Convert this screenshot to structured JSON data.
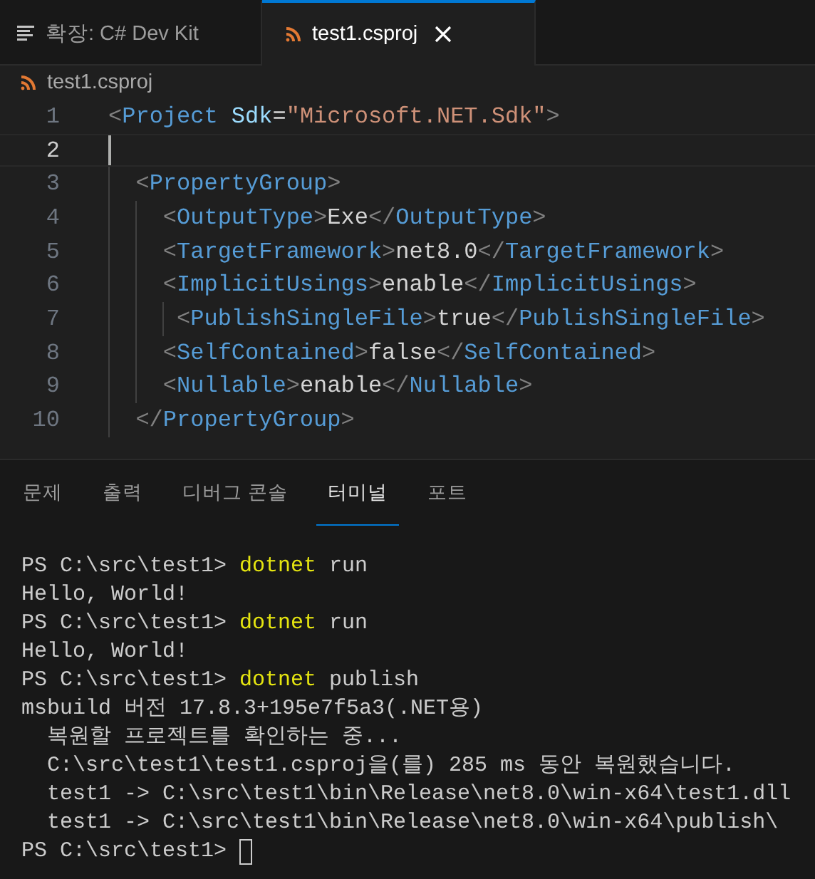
{
  "editor_tabs": [
    {
      "label": "확장: C# Dev Kit",
      "kind": "preview",
      "selected": false
    },
    {
      "label": "test1.csproj",
      "kind": "file",
      "selected": true
    }
  ],
  "breadcrumb": "test1.csproj",
  "code_lines": [
    {
      "number": "1",
      "active": false,
      "tokens": [
        {
          "kind": "punct",
          "text": "<"
        },
        {
          "kind": "tag",
          "text": "Project"
        },
        {
          "kind": "attr",
          "text": " Sdk"
        },
        {
          "kind": "text",
          "text": "="
        },
        {
          "kind": "string",
          "text": "\"Microsoft.NET.Sdk\""
        },
        {
          "kind": "punct",
          "text": ">"
        }
      ]
    },
    {
      "number": "2",
      "active": true
    },
    {
      "number": "3",
      "active": false,
      "tokens": [
        {
          "kind": "punct",
          "text": "  <"
        },
        {
          "kind": "tag",
          "text": "PropertyGroup"
        },
        {
          "kind": "punct",
          "text": ">"
        }
      ]
    },
    {
      "number": "4",
      "active": false,
      "tokens": [
        {
          "kind": "punct",
          "text": "    <"
        },
        {
          "kind": "tag",
          "text": "OutputType"
        },
        {
          "kind": "punct",
          "text": ">"
        },
        {
          "kind": "text",
          "text": "Exe"
        },
        {
          "kind": "punct",
          "text": "</"
        },
        {
          "kind": "tag",
          "text": "OutputType"
        },
        {
          "kind": "punct",
          "text": ">"
        }
      ]
    },
    {
      "number": "5",
      "active": false,
      "tokens": [
        {
          "kind": "punct",
          "text": "    <"
        },
        {
          "kind": "tag",
          "text": "TargetFramework"
        },
        {
          "kind": "punct",
          "text": ">"
        },
        {
          "kind": "text",
          "text": "net8.0"
        },
        {
          "kind": "punct",
          "text": "</"
        },
        {
          "kind": "tag",
          "text": "TargetFramework"
        },
        {
          "kind": "punct",
          "text": ">"
        }
      ]
    },
    {
      "number": "6",
      "active": false,
      "tokens": [
        {
          "kind": "punct",
          "text": "    <"
        },
        {
          "kind": "tag",
          "text": "ImplicitUsings"
        },
        {
          "kind": "punct",
          "text": ">"
        },
        {
          "kind": "text",
          "text": "enable"
        },
        {
          "kind": "punct",
          "text": "</"
        },
        {
          "kind": "tag",
          "text": "ImplicitUsings"
        },
        {
          "kind": "punct",
          "text": ">"
        }
      ]
    },
    {
      "number": "7",
      "active": false,
      "tokens": [
        {
          "kind": "punct",
          "text": "     <"
        },
        {
          "kind": "tag",
          "text": "PublishSingleFile"
        },
        {
          "kind": "punct",
          "text": ">"
        },
        {
          "kind": "text",
          "text": "true"
        },
        {
          "kind": "punct",
          "text": "</"
        },
        {
          "kind": "tag",
          "text": "PublishSingleFile"
        },
        {
          "kind": "punct",
          "text": ">"
        }
      ]
    },
    {
      "number": "8",
      "active": false,
      "tokens": [
        {
          "kind": "punct",
          "text": "    <"
        },
        {
          "kind": "tag",
          "text": "SelfContained"
        },
        {
          "kind": "punct",
          "text": ">"
        },
        {
          "kind": "text",
          "text": "false"
        },
        {
          "kind": "punct",
          "text": "</"
        },
        {
          "kind": "tag",
          "text": "SelfContained"
        },
        {
          "kind": "punct",
          "text": ">"
        }
      ]
    },
    {
      "number": "9",
      "active": false,
      "tokens": [
        {
          "kind": "punct",
          "text": "    <"
        },
        {
          "kind": "tag",
          "text": "Nullable"
        },
        {
          "kind": "punct",
          "text": ">"
        },
        {
          "kind": "text",
          "text": "enable"
        },
        {
          "kind": "punct",
          "text": "</"
        },
        {
          "kind": "tag",
          "text": "Nullable"
        },
        {
          "kind": "punct",
          "text": ">"
        }
      ]
    },
    {
      "number": "10",
      "active": false,
      "tokens": [
        {
          "kind": "punct",
          "text": "  </"
        },
        {
          "kind": "tag",
          "text": "PropertyGroup"
        },
        {
          "kind": "punct",
          "text": ">"
        }
      ]
    }
  ],
  "panel_tabs": [
    {
      "label": "문제",
      "selected": false
    },
    {
      "label": "출력",
      "selected": false
    },
    {
      "label": "디버그 콘솔",
      "selected": false
    },
    {
      "label": "터미널",
      "selected": true
    },
    {
      "label": "포트",
      "selected": false
    }
  ],
  "terminal_lines": [
    [
      {
        "kind": "prompt",
        "text": "PS C:\\src\\test1> "
      },
      {
        "kind": "command",
        "text": "dotnet"
      },
      {
        "kind": "output",
        "text": " run"
      }
    ],
    [
      {
        "kind": "output",
        "text": "Hello, World!"
      }
    ],
    [
      {
        "kind": "prompt",
        "text": "PS C:\\src\\test1> "
      },
      {
        "kind": "command",
        "text": "dotnet"
      },
      {
        "kind": "output",
        "text": " run"
      }
    ],
    [
      {
        "kind": "output",
        "text": "Hello, World!"
      }
    ],
    [
      {
        "kind": "prompt",
        "text": "PS C:\\src\\test1> "
      },
      {
        "kind": "command",
        "text": "dotnet"
      },
      {
        "kind": "output",
        "text": " publish"
      }
    ],
    [
      {
        "kind": "output",
        "text": "msbuild 버전 17.8.3+195e7f5a3(.NET용)"
      }
    ],
    [
      {
        "kind": "output",
        "text": "  복원할 프로젝트를 확인하는 중..."
      }
    ],
    [
      {
        "kind": "output",
        "text": "  C:\\src\\test1\\test1.csproj을(를) 285 ms 동안 복원했습니다."
      }
    ],
    [
      {
        "kind": "output",
        "text": "  test1 -> C:\\src\\test1\\bin\\Release\\net8.0\\win-x64\\test1.dll"
      }
    ],
    [
      {
        "kind": "output",
        "text": "  test1 -> C:\\src\\test1\\bin\\Release\\net8.0\\win-x64\\publish\\"
      }
    ],
    [
      {
        "kind": "prompt",
        "text": "PS C:\\src\\test1> "
      },
      {
        "kind": "cursor"
      }
    ]
  ]
}
